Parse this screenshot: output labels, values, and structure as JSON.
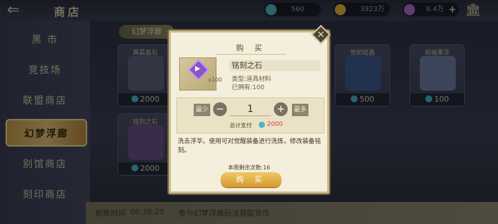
{
  "topbar": {
    "back_icon": "back-arrow-icon",
    "title": "商店",
    "currencies": [
      {
        "value": "560",
        "color": "#4fb3c7",
        "icon": "gem-currency-icon"
      },
      {
        "value": "3923万",
        "color": "#e2b244",
        "icon": "gold-coin-icon"
      },
      {
        "value": "6.4万",
        "color": "#b26ad8",
        "icon": "rainbow-orb-icon"
      }
    ],
    "plus_label": "+",
    "bank_icon": "bank-icon"
  },
  "sidebar": {
    "items": [
      {
        "label": "黑 市"
      },
      {
        "label": "竞技场"
      },
      {
        "label": "联盟商店"
      },
      {
        "label": "幻梦浮廊",
        "active": true
      },
      {
        "label": "别馆商店"
      },
      {
        "label": "刻印商店"
      }
    ]
  },
  "main": {
    "section_tab": "幻梦浮廊",
    "cards": [
      {
        "name": "真晨晶石",
        "price": "2000"
      },
      {
        "name": "铭刻之石",
        "price": "2000"
      },
      {
        "name": "觉初结晶",
        "price": "500"
      },
      {
        "name": "祝福果冻",
        "price": "100"
      }
    ],
    "refresh_label": "刷新时间",
    "refresh_time": "06:38:20",
    "refresh_desc": "参与幻梦浮廊玩法获取货币"
  },
  "modal": {
    "title": "购 买",
    "item_name": "铭刻之石",
    "item_count": "x100",
    "item_type": "类型:道具材料",
    "item_owned": "已拥有:100",
    "qty_min_label": "最少",
    "qty_max_label": "最多",
    "qty_minus": "−",
    "qty_plus": "+",
    "quantity": "1",
    "total_label": "总计支付",
    "total_value": "2000",
    "description": "洗去浮华，使用可对觉醒装备进行洗炼，修改装备铭刻。",
    "week_left": "本周剩余次数:16",
    "buy_label": "购 买",
    "close": "×"
  }
}
